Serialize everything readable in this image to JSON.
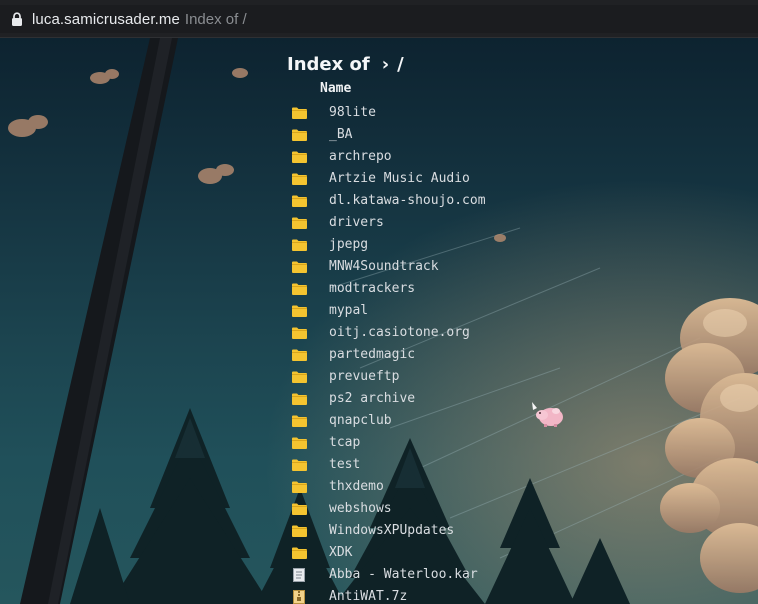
{
  "browser": {
    "host": "luca.samicrusader.me",
    "path_title": "Index of /"
  },
  "page": {
    "heading_label": "Index of",
    "heading_separator": "›",
    "heading_path": "/",
    "column_name": "Name"
  },
  "entries": [
    {
      "name": "98lite",
      "type": "folder-icon"
    },
    {
      "name": "_BA",
      "type": "folder-icon"
    },
    {
      "name": "archrepo",
      "type": "folder-icon"
    },
    {
      "name": "Artzie Music Audio",
      "type": "folder-icon"
    },
    {
      "name": "dl.katawa-shoujo.com",
      "type": "folder-icon"
    },
    {
      "name": "drivers",
      "type": "folder-icon"
    },
    {
      "name": "jpepg",
      "type": "folder-icon"
    },
    {
      "name": "MNW4Soundtrack",
      "type": "folder-icon"
    },
    {
      "name": "modtrackers",
      "type": "folder-icon"
    },
    {
      "name": "mypal",
      "type": "folder-icon"
    },
    {
      "name": "oitj.casiotone.org",
      "type": "folder-icon"
    },
    {
      "name": "partedmagic",
      "type": "folder-icon"
    },
    {
      "name": "prevueftp",
      "type": "folder-icon"
    },
    {
      "name": "ps2 archive",
      "type": "folder-icon"
    },
    {
      "name": "qnapclub",
      "type": "folder-icon"
    },
    {
      "name": "tcap",
      "type": "folder-icon"
    },
    {
      "name": "test",
      "type": "folder-icon"
    },
    {
      "name": "thxdemo",
      "type": "folder-icon"
    },
    {
      "name": "webshows",
      "type": "folder-icon"
    },
    {
      "name": "WindowsXPUpdates",
      "type": "folder-icon"
    },
    {
      "name": "XDK",
      "type": "folder-icon"
    },
    {
      "name": "Abba - Waterloo.kar",
      "type": "file-icon"
    },
    {
      "name": "AntiWAT.7z",
      "type": "archive-icon"
    }
  ],
  "colors": {
    "folder": "#f4c430",
    "text": "#d9dde1",
    "heading": "#f4f6f8"
  }
}
